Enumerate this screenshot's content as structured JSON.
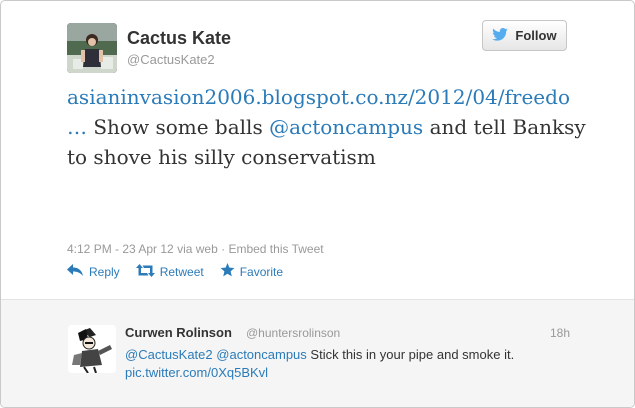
{
  "tweet": {
    "author_name": "Cactus Kate",
    "author_handle": "@CactusKate2",
    "follow_label": "Follow",
    "link_text": "asianinvasion2006.blogspot.co.nz/2012/04/freedo",
    "link_ellipsis": "…",
    "text_before_mention": "Show some balls",
    "mention": "@actoncampus",
    "text_after_mention": "and tell Banksy to shove his silly conservatism",
    "timestamp": "4:12 PM - 23 Apr 12",
    "via": "via web",
    "separator": "·",
    "embed_label": "Embed this Tweet",
    "actions": {
      "reply": "Reply",
      "retweet": "Retweet",
      "favorite": "Favorite"
    }
  },
  "reply": {
    "author_name": "Curwen Rolinson",
    "author_handle": "@huntersrolinson",
    "time_ago": "18h",
    "mention_1": "@CactusKate2",
    "mention_2": "@actoncampus",
    "text": "Stick this in your pipe and smoke it.",
    "pic_link": "pic.twitter.com/0Xq5BKvl"
  },
  "colors": {
    "link": "#2b7bb9",
    "text": "#333333",
    "muted": "#999999",
    "reply_bg": "#f5f5f5",
    "bird": "#55acee"
  }
}
